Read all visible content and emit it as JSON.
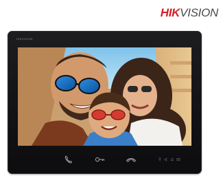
{
  "brand": {
    "part1": "HIK",
    "part2": "VISION",
    "accent_color": "#d61f26",
    "text_color": "#4b4b4b"
  },
  "device": {
    "logo_text": "HIKVISION",
    "buttons": [
      {
        "name": "call",
        "icon": "phone-handset-icon"
      },
      {
        "name": "unlock",
        "icon": "key-icon"
      },
      {
        "name": "hang-up",
        "icon": "hang-up-icon"
      }
    ],
    "indicators": [
      "mic-indicator",
      "mute-indicator",
      "alarm-indicator",
      "message-indicator"
    ]
  }
}
